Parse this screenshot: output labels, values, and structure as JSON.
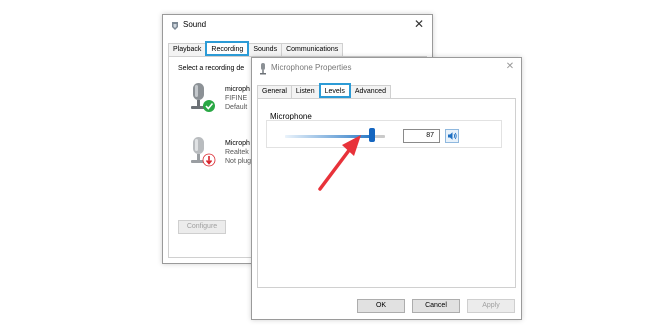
{
  "sound_dialog": {
    "title": "Sound",
    "close_glyph": "✕",
    "tabs": [
      {
        "label": "Playback",
        "selected": false
      },
      {
        "label": "Recording",
        "selected": true
      },
      {
        "label": "Sounds",
        "selected": false
      },
      {
        "label": "Communications",
        "selected": false
      }
    ],
    "instruction": "Select a recording de",
    "devices": [
      {
        "name": "microph",
        "line2": "FIFINE",
        "line3": "Default",
        "status_icon": "green-check-icon"
      },
      {
        "name": "Microph",
        "line2": "Realtek",
        "line3": "Not plug",
        "status_icon": "red-down-arrow-icon"
      }
    ],
    "configure_label": "Configure"
  },
  "mic_properties": {
    "title": "Microphone Properties",
    "close_glyph": "✕",
    "tabs": [
      {
        "label": "General",
        "selected": false
      },
      {
        "label": "Listen",
        "selected": false
      },
      {
        "label": "Levels",
        "selected": true
      },
      {
        "label": "Advanced",
        "selected": false
      }
    ],
    "group_label": "Microphone",
    "level_value": "87",
    "level_percent": 87,
    "buttons": {
      "ok": "OK",
      "cancel": "Cancel",
      "apply": "Apply"
    }
  },
  "colors": {
    "tab_highlight": "#2c9bd6",
    "slider_thumb": "#1566c0",
    "annotation_arrow": "#e8323a",
    "check_badge": "#2aa845",
    "unplugged_badge": "#d9222a"
  },
  "icons": [
    "microphone-icon",
    "speaker-icon",
    "sound-icon",
    "green-check-icon",
    "red-down-arrow-icon",
    "close-icon",
    "red-annotation-arrow"
  ]
}
